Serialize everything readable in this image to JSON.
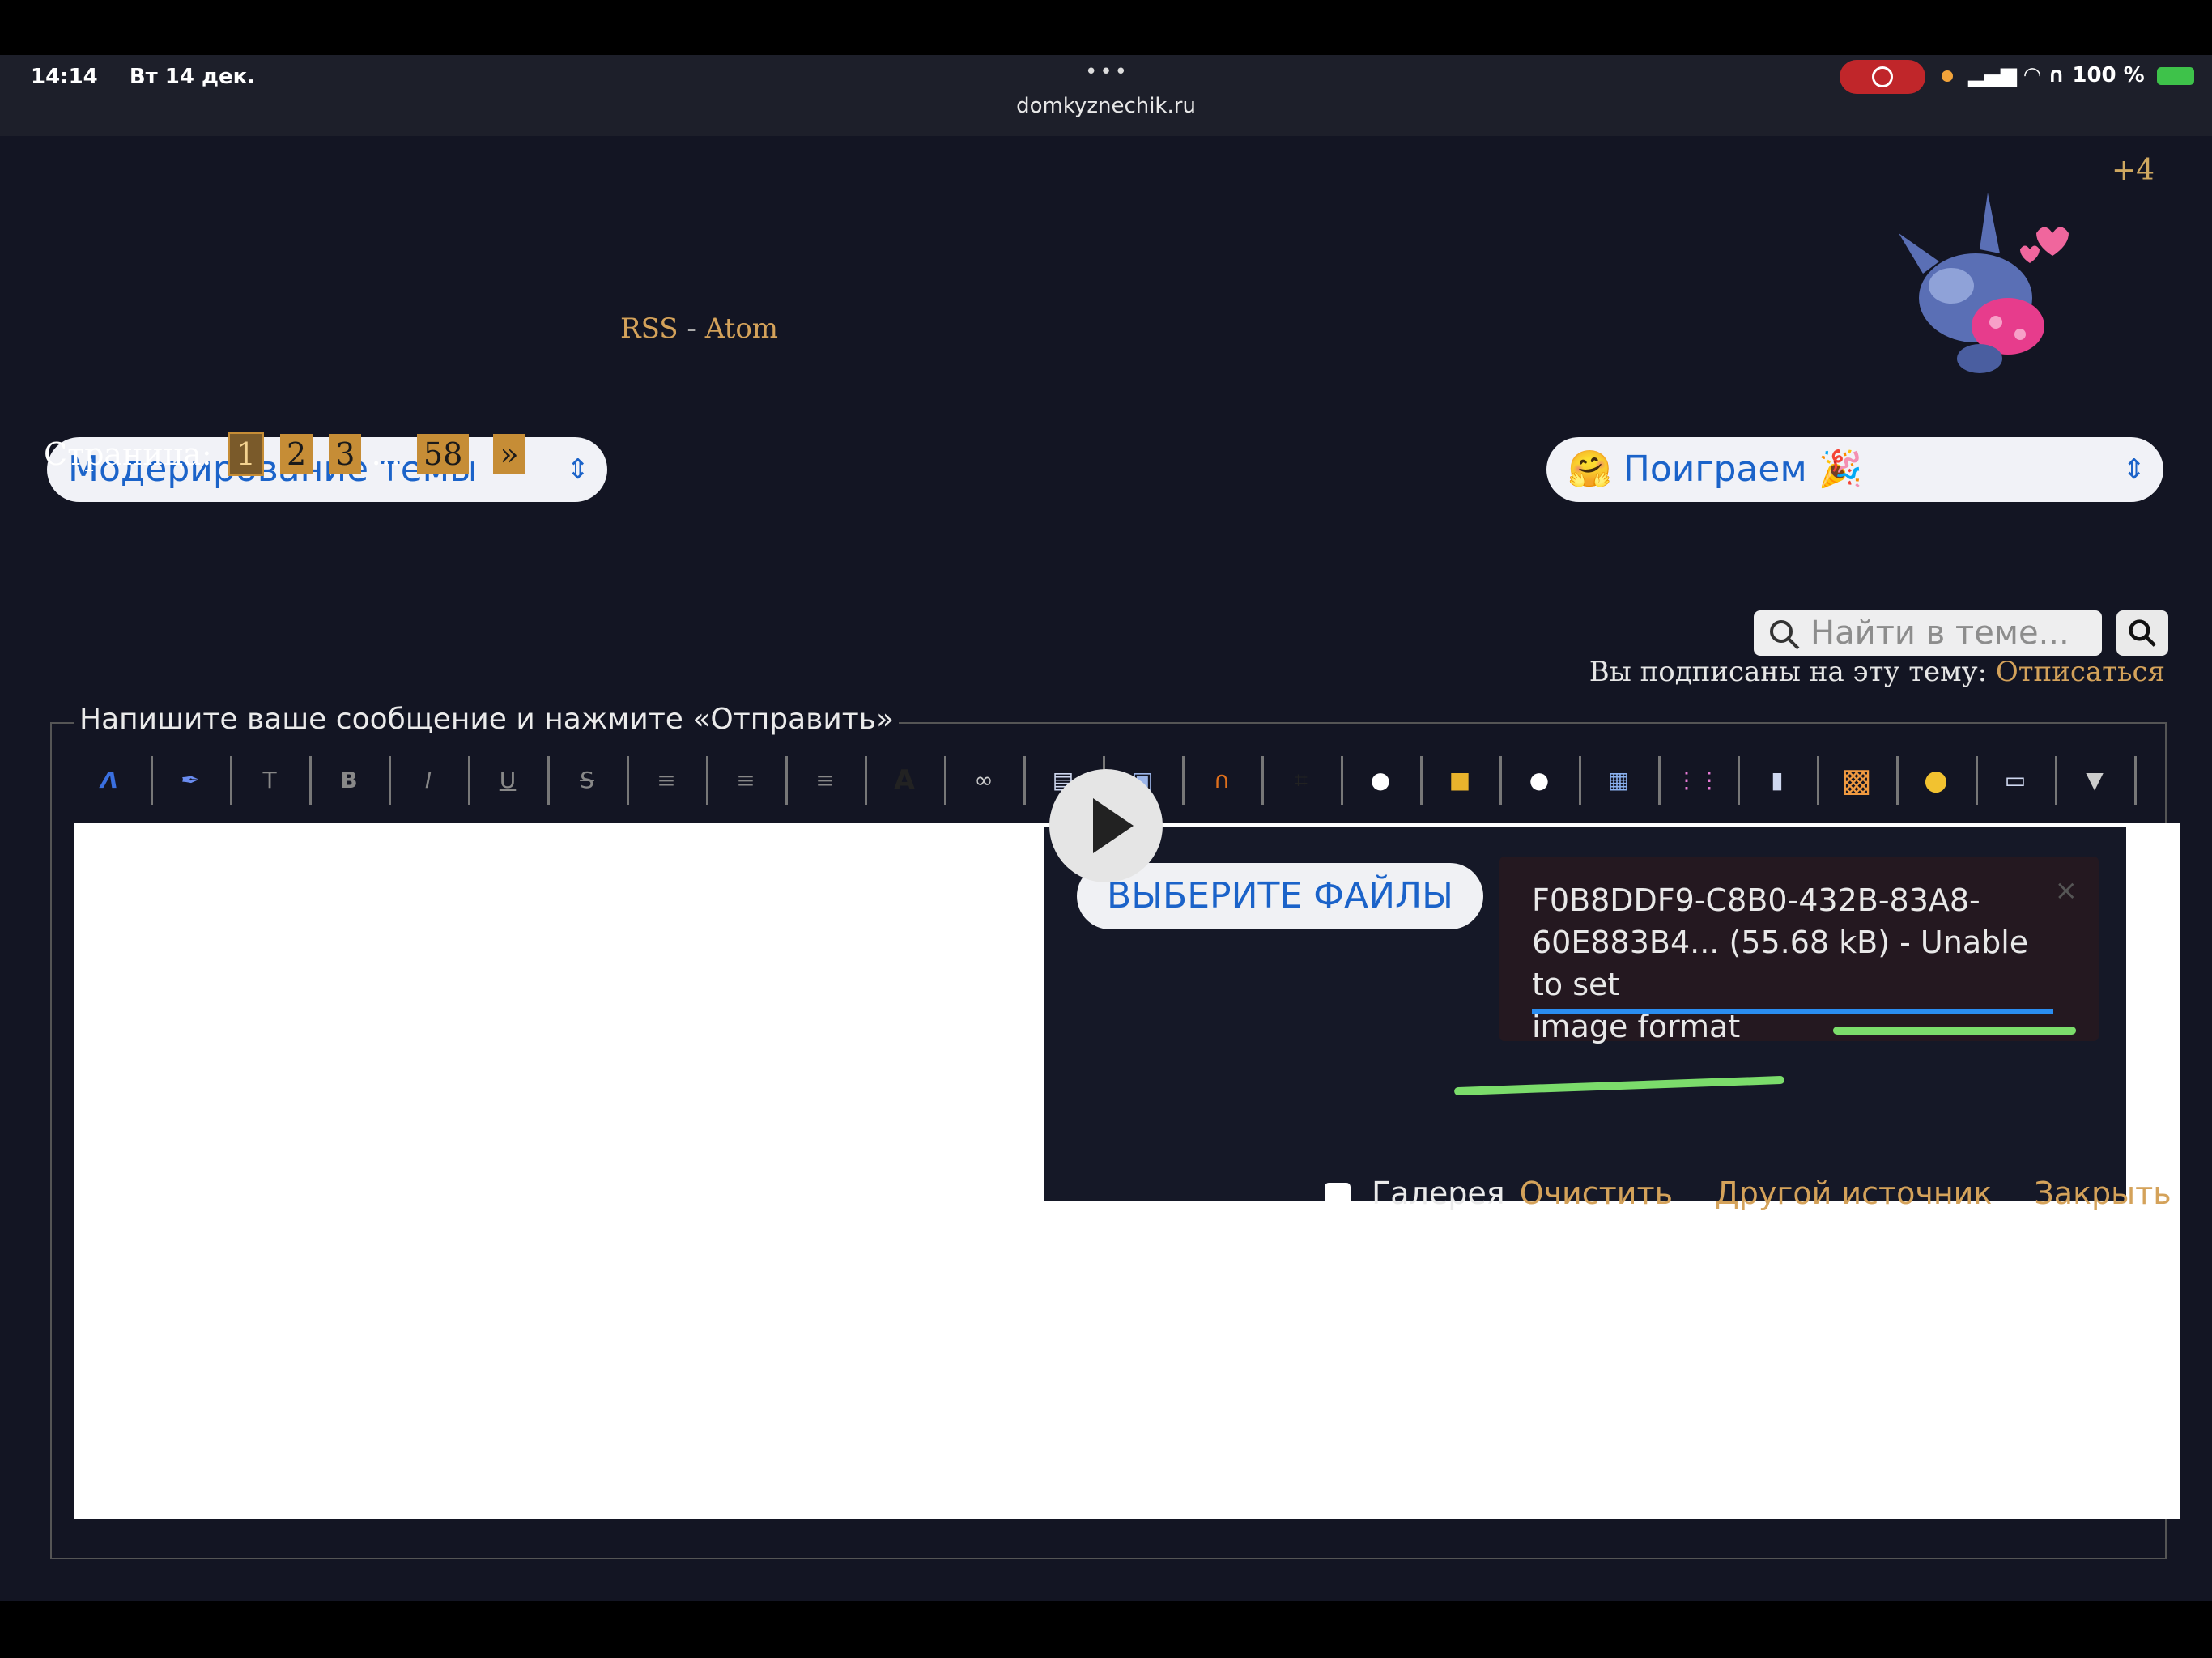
{
  "status_bar": {
    "time": "14:14",
    "date": "Вт 14 дек.",
    "dots": "•••",
    "url": "domkyznechik.ru",
    "battery": "100 %"
  },
  "header": {
    "badge": "+4"
  },
  "controls": {
    "moderation_select": "Модерирование темы",
    "rss": "RSS",
    "separator": "-",
    "atom": "Atom",
    "forum_select": "🤗 Поиграем 🎉"
  },
  "pagination": {
    "label": "Страница:",
    "pages": [
      "1",
      "2",
      "3"
    ],
    "ellipsis": "...",
    "last": "58",
    "next": "»"
  },
  "search": {
    "placeholder": "Найти в теме..."
  },
  "subscription": {
    "text": "Вы подписаны на эту тему:",
    "unsubscribe": "Отписаться"
  },
  "editor": {
    "legend": "Напишите ваше сообщение и нажмите «Отправить»",
    "toolbar_letters": {
      "t": "T",
      "b": "B",
      "i": "I",
      "u": "U",
      "s": "S",
      "a": "A"
    }
  },
  "upload": {
    "choose_files": "ВЫБЕРИТЕ ФАЙЛЫ",
    "error_line1": "F0B8DDF9-C8B0-432B-83A8-",
    "error_line2": "60E883B4... (55.68 kB) - Unable to set",
    "error_line3": "image format",
    "close_x": "×",
    "gallery": "Галерея",
    "clear": "Очистить",
    "other_source": "Другой источник",
    "close": "Закрыть"
  },
  "colors": {
    "background": "#131523",
    "accent_blue": "#1b63c9",
    "link_gold": "#d4a25a",
    "annotation_green": "#7bdc6b"
  }
}
